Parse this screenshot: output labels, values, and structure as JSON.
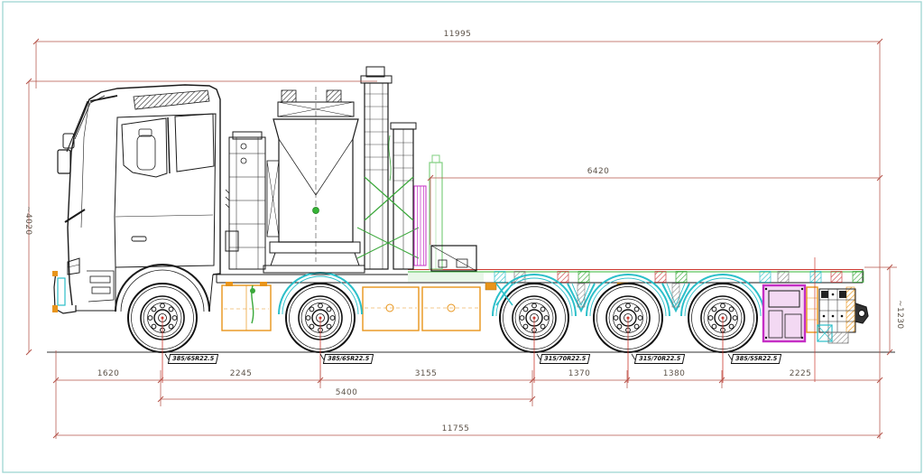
{
  "drawing": {
    "type": "truck-crane-side-view-cad",
    "dims": {
      "overall_top": "11995",
      "mid_length": "6420",
      "overall_height": "~4020",
      "rear_frame_height": "~1230",
      "front_overhang": "1620",
      "axle1_axle2": "2245",
      "axle2_axle3": "3155",
      "axle3_axle4": "1370",
      "axle4_axle5": "1380",
      "rear_overhang": "2225",
      "axle1_axle3": "5400",
      "overall_bottom": "11755"
    },
    "tires": {
      "axle1": "385/65R22.5",
      "axle2": "385/65R22.5",
      "axle3": "315/70R22.5",
      "axle4": "315/70R22.5",
      "axle5": "385/55R22.5"
    },
    "colors": {
      "dimension_line": "#b5544a",
      "axle_line": "#cc3a30",
      "outline": "#1a1a1a",
      "cyan_accent": "#2bbfc9",
      "green_accent": "#35b435",
      "magenta_accent": "#c52fc5",
      "orange_accent": "#e8941a",
      "sheet_border": "#9fd6d2"
    }
  }
}
